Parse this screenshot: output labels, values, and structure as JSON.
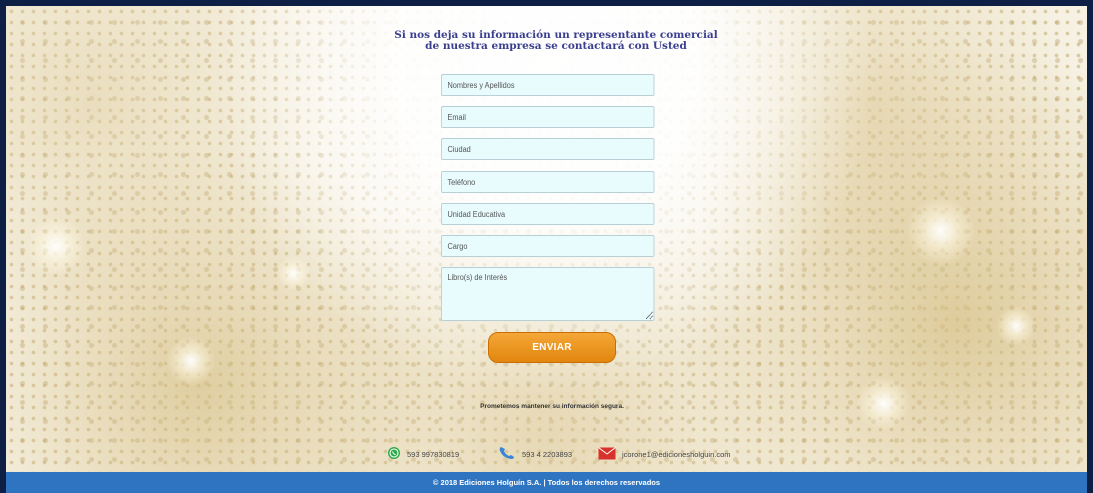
{
  "form": {
    "heading_line1": "Si nos deja su información un representante comercial",
    "heading_line2": "de nuestra empresa se contactará con Usted",
    "fields": {
      "name_placeholder": "Nombres y Apellidos",
      "email_placeholder": "Email",
      "city_placeholder": "Ciudad",
      "phone_placeholder": "Teléfono",
      "school_placeholder": "Unidad Educativa",
      "position_placeholder": "Cargo",
      "books_placeholder": "Libro(s) de Interés"
    },
    "submit_label": "ENVIAR",
    "privacy_note": "Prometemos mantener su información segura."
  },
  "contacts": {
    "whatsapp": {
      "icon": "whatsapp-icon",
      "text": "593 997830819",
      "color": "#2eaa4a"
    },
    "phone": {
      "icon": "phone-icon",
      "text": "593 4 2203893",
      "color": "#3a86d6"
    },
    "email": {
      "icon": "envelope-icon",
      "text": "jcorone1@edicionesholguin.com",
      "color": "#d7322c"
    }
  },
  "footer": {
    "text": "© 2018  Ediciones Holguín S.A. | Todos los derechos reservados",
    "color": "#2f74c1"
  },
  "colors": {
    "heading": "#3b3f8f",
    "button": "#e8910f",
    "field_bg": "#e8fbfd"
  }
}
